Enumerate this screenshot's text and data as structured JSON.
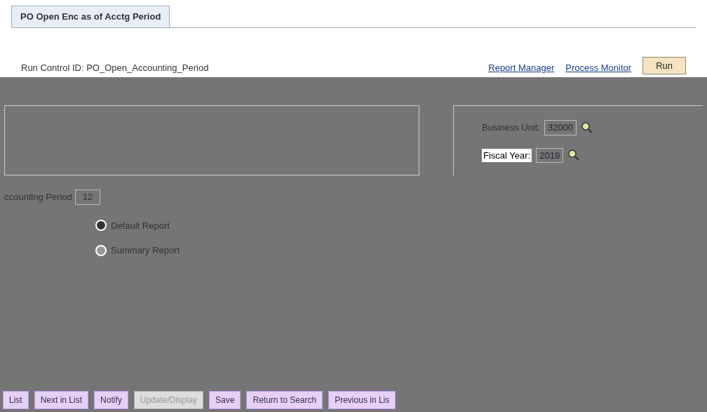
{
  "tab": {
    "label": "PO Open Enc as of Acctg Period",
    "selected": true
  },
  "header": {
    "run_control": "Run Control ID: PO_Open_Accounting_Period",
    "links": [
      "Report Manager",
      "Process Monitor"
    ],
    "run_button": "Run"
  },
  "fields": [
    {
      "label": "Business Unit:",
      "value": "32000",
      "lookup": true
    },
    {
      "label": "Fiscal Year:",
      "value": "2019",
      "lookup": true
    },
    {
      "label": "ccounting Period",
      "value": "12",
      "lookup": false
    }
  ],
  "options": [
    {
      "label": "Default Report",
      "selected": true
    },
    {
      "label": "Summary Report",
      "selected": false
    }
  ],
  "toolbar": [
    {
      "label": "List",
      "disabled": false
    },
    {
      "label": "Next in List",
      "disabled": false
    },
    {
      "label": "Notify",
      "disabled": false
    },
    {
      "label": "Update/Display",
      "disabled": true
    },
    {
      "label": "Save",
      "disabled": false
    },
    {
      "label": "Return to Search",
      "disabled": false
    },
    {
      "label": "Previous in Lis",
      "disabled": false
    }
  ]
}
